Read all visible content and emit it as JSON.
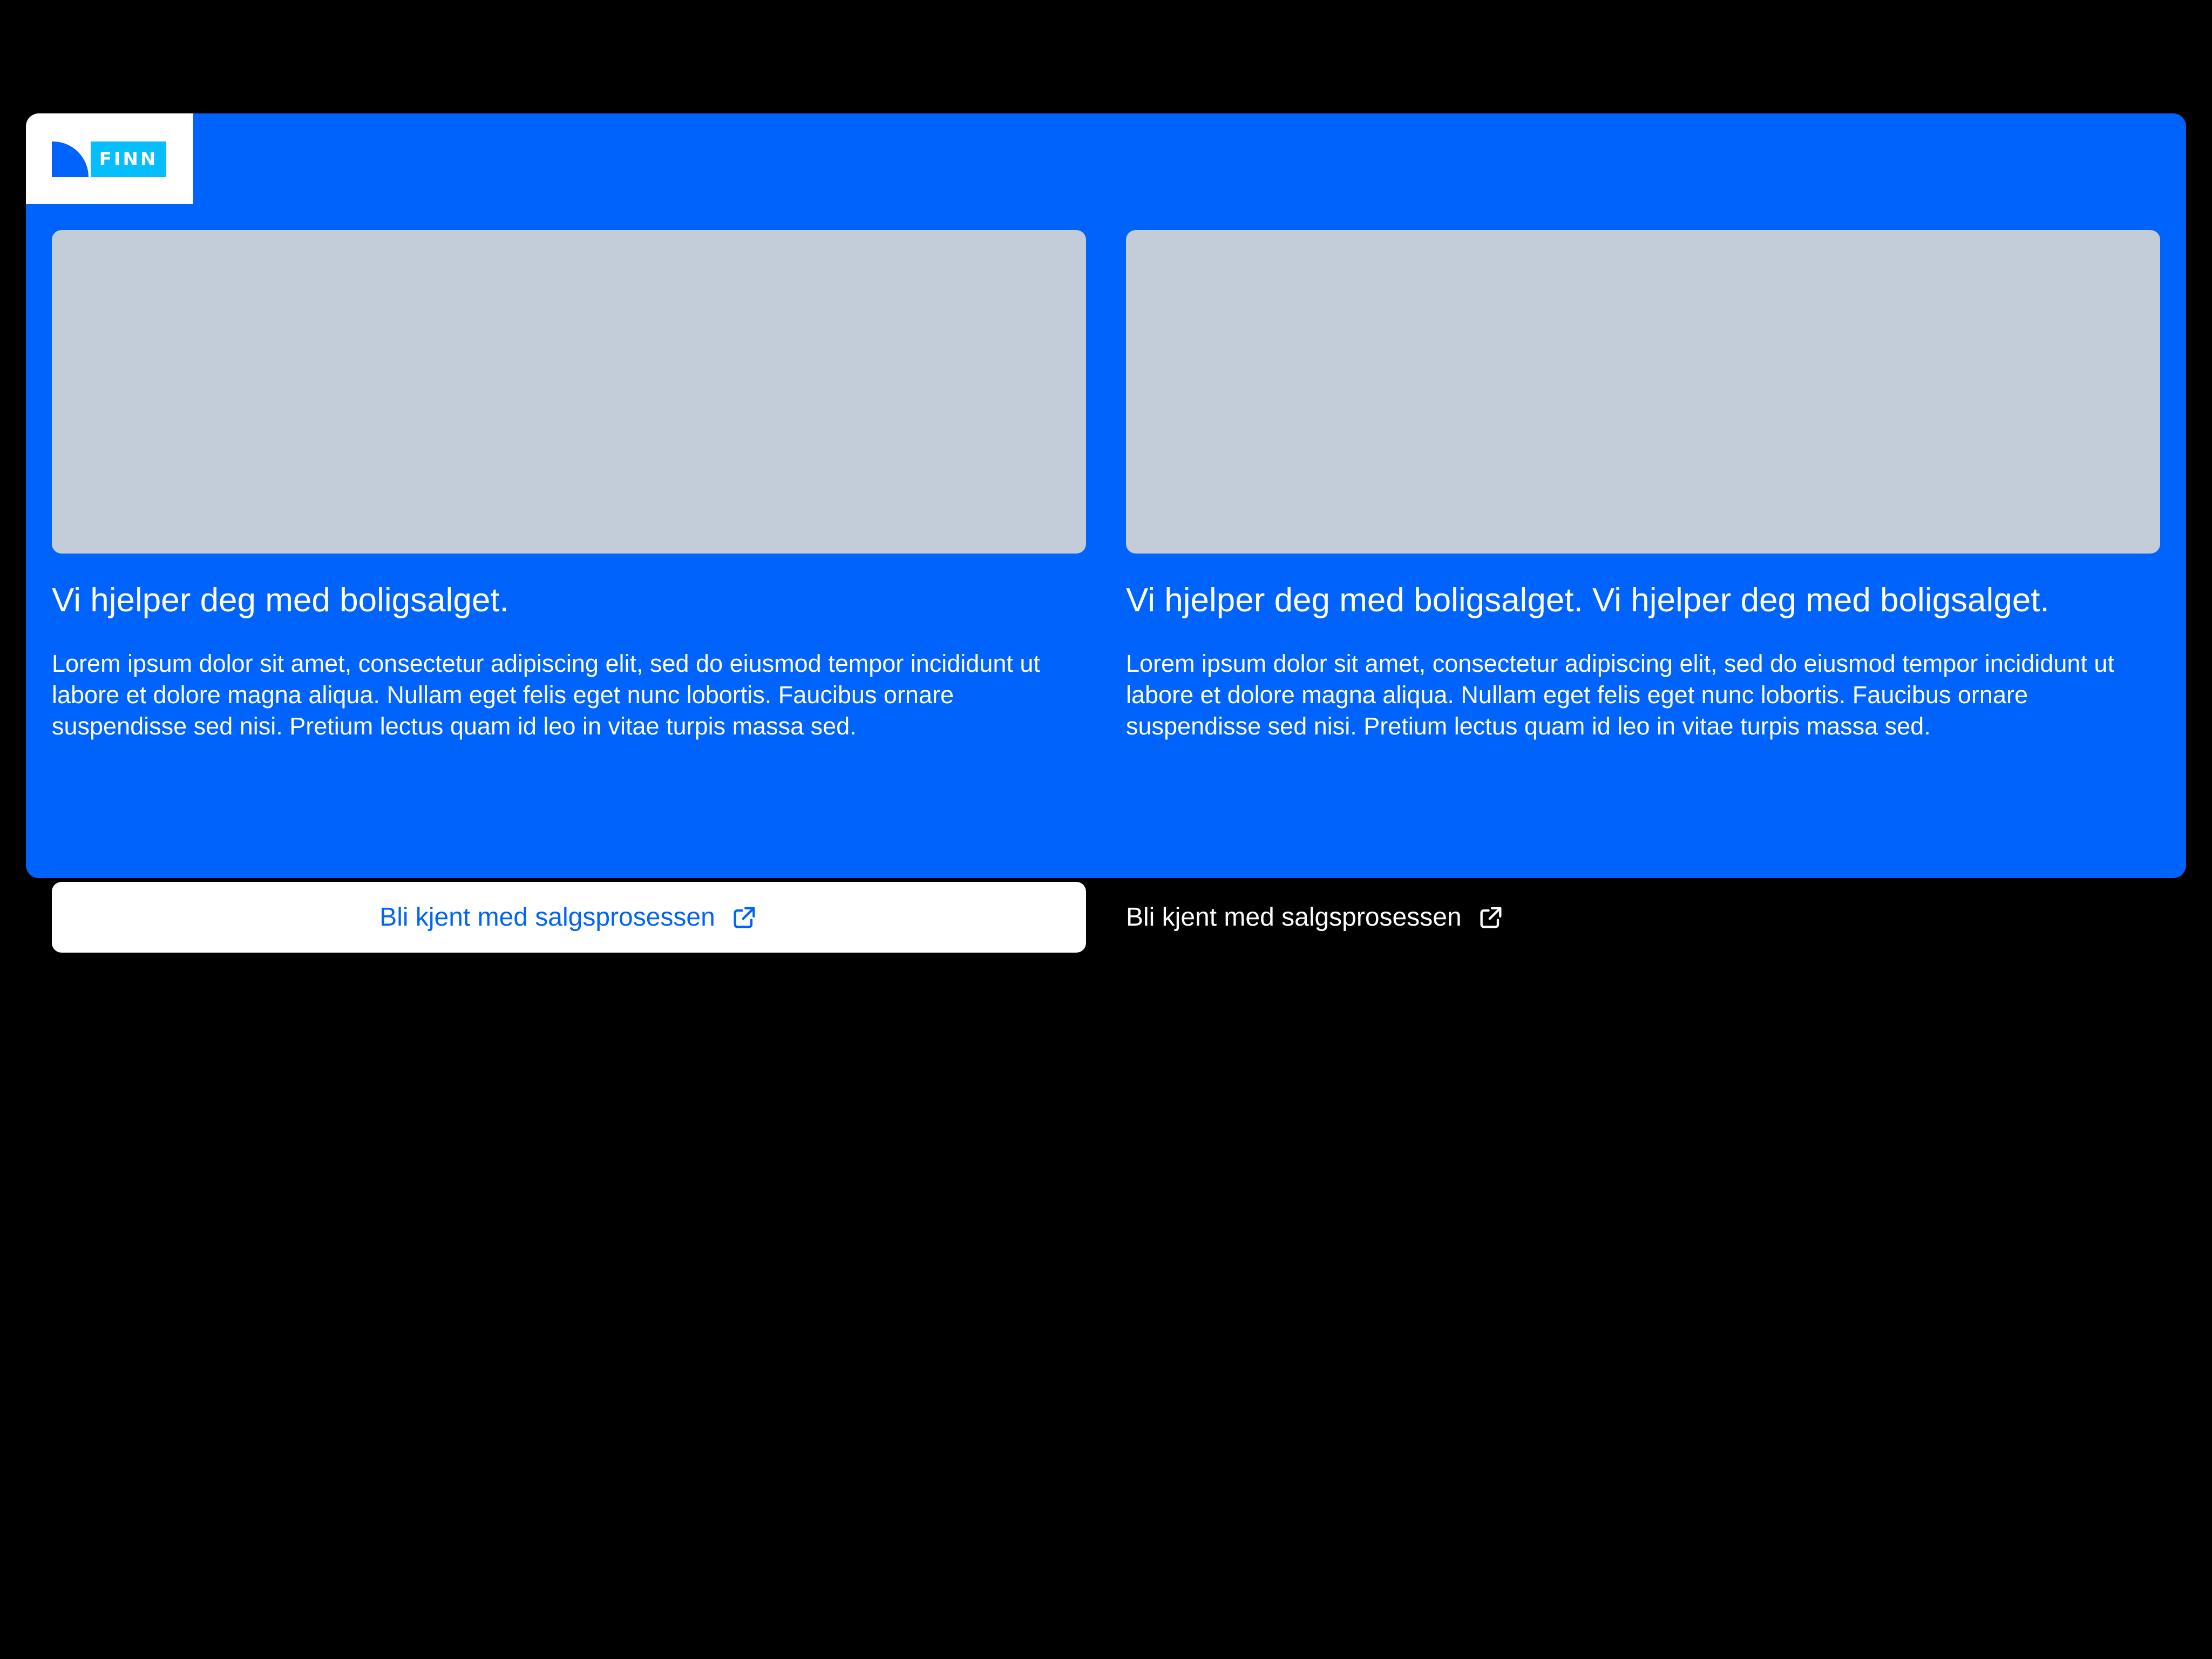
{
  "brand": {
    "logo_text": "FINN",
    "primary_color": "#0063FB",
    "secondary_color": "#06BEFB"
  },
  "cards": [
    {
      "image_icon": "image-placeholder",
      "title": "Vi hjelper deg med boligsalget.",
      "body": "Lorem ipsum dolor sit amet, consectetur adipiscing elit, sed do eiusmod tempor incididunt ut labore et dolore magna aliqua. Nullam eget felis eget nunc lobortis. Faucibus ornare suspendisse sed nisi. Pretium lectus quam id leo in vitae turpis massa sed.",
      "cta_label": "Bli kjent med salgsprosessen",
      "cta_icon": "external-link-icon",
      "cta_style": "primary-button"
    },
    {
      "image_icon": "image-placeholder",
      "title": "Vi hjelper deg med boligsalget. Vi hjelper deg med boligsalget.",
      "body": "Lorem ipsum dolor sit amet, consectetur adipiscing elit, sed do eiusmod tempor incididunt ut labore et dolore magna aliqua. Nullam eget felis eget nunc lobortis. Faucibus ornare suspendisse sed nisi. Pretium lectus quam id leo in vitae turpis massa sed.",
      "cta_label": "Bli kjent med salgsprosessen",
      "cta_icon": "external-link-icon",
      "cta_style": "text-link"
    }
  ]
}
